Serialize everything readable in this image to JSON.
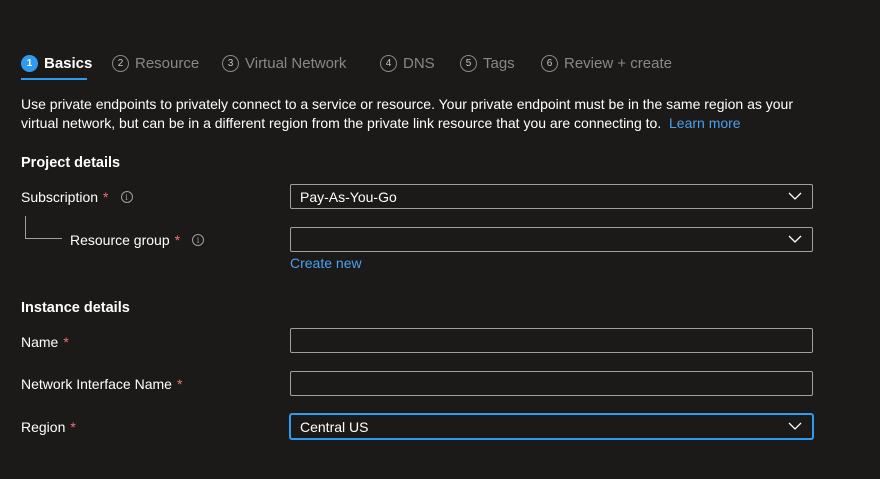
{
  "tabs": [
    {
      "num": "1",
      "label": "Basics"
    },
    {
      "num": "2",
      "label": "Resource"
    },
    {
      "num": "3",
      "label": "Virtual Network"
    },
    {
      "num": "4",
      "label": "DNS"
    },
    {
      "num": "5",
      "label": "Tags"
    },
    {
      "num": "6",
      "label": "Review + create"
    }
  ],
  "active_tab": "Basics",
  "description": {
    "text": "Use private endpoints to privately connect to a service or resource. Your private endpoint must be in the same region as your virtual network, but can be in a different region from the private link resource that you are connecting to.",
    "link": "Learn more"
  },
  "project_details": {
    "title": "Project details",
    "subscription": {
      "label": "Subscription",
      "required": "*",
      "value": "Pay-As-You-Go"
    },
    "resource_group": {
      "label": "Resource group",
      "required": "*",
      "value": "",
      "create_new": "Create new"
    }
  },
  "instance_details": {
    "title": "Instance details",
    "name": {
      "label": "Name",
      "required": "*",
      "value": ""
    },
    "nic_name": {
      "label": "Network Interface Name",
      "required": "*",
      "value": ""
    },
    "region": {
      "label": "Region",
      "required": "*",
      "value": "Central US"
    }
  },
  "icons": {
    "info": "info-icon",
    "dropdown": "chevron-down-icon"
  },
  "colors": {
    "background": "#1b1a19",
    "accent": "#2f9bf0",
    "link": "#4aa0f0",
    "required": "#f1707b",
    "border": "#a19f9d"
  }
}
